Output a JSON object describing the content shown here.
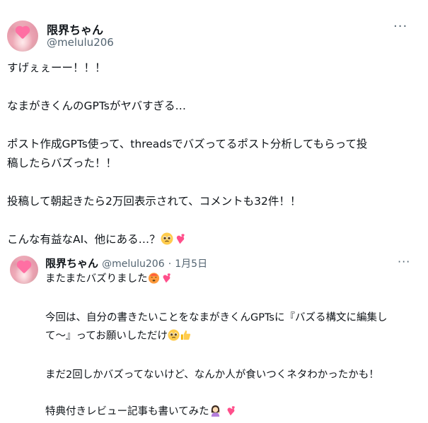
{
  "main_post": {
    "author_name": "限界ちゃん",
    "author_handle": "@melulu206",
    "lines": [
      "すげぇぇーー！！！",
      "",
      "なまがきくんのGPTsがヤバすぎる…",
      "",
      "ポスト作成GPTs使って、threadsでバズってるポスト分析してもらって投",
      "稿したらバズった！！",
      "",
      "投稿して朝起きたら2万回表示されて、コメントも32件！！",
      "",
      "こんな有益なAI、他にある…？"
    ],
    "more_label": "···"
  },
  "quoted_post": {
    "author_name": "限界ちゃん",
    "author_handle": "@melulu206",
    "separator": "·",
    "date": "1月5日",
    "lines": [
      "またまたバズりました",
      "",
      "今回は、自分の書きたいことをなまがきくんGPTsに『バズる構文に編集し",
      "て〜』ってお願いしただけ",
      "",
      "まだ2回しかバズってないけど、なんか人が食いつくネタわかったかも！",
      "",
      "特典付きレビュー記事も書いてみた"
    ],
    "more_label": "···"
  },
  "colors": {
    "text": "#0f1419",
    "secondary": "#536471",
    "heart_pink": "#ff4f8b"
  },
  "icons": [
    "pleading-face-icon",
    "two-hearts-icon",
    "hot-face-icon",
    "thumbs-up-icon",
    "woman-tipping-hand-icon"
  ]
}
